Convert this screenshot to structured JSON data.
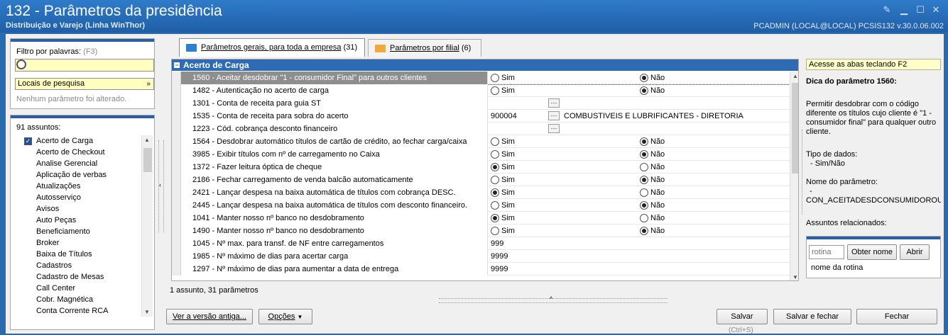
{
  "window": {
    "title": "132 - Parâmetros da presidência",
    "subtitle": "Distribuição e Varejo (Linha WinThor)",
    "user_info": "PCADMIN (LOCAL@LOCAL)   PCSIS132  v.30.0.06.002"
  },
  "filter": {
    "label": "Filtro por palavras:",
    "shortcut": "(F3)",
    "input_value": "",
    "dropdown_value": "Locais de pesquisa",
    "status": "Nenhum parâmetro foi alterado."
  },
  "subjects": {
    "count_label": "91 assuntos:",
    "items": [
      "Acerto de Carga",
      "Acerto de Checkout",
      "Analise Gerencial",
      "Aplicação de verbas",
      "Atualizações",
      "Autosserviço",
      "Avisos",
      "Auto Peças",
      "Beneficiamento",
      "Broker",
      "Baixa de Títulos",
      "Cadastros",
      "Cadastro de Mesas",
      "Call Center",
      "Cobr. Magnética",
      "Conta Corrente RCA"
    ]
  },
  "tabs": [
    {
      "label": "Parâmetros gerais, para toda a empresa",
      "count": "(31)"
    },
    {
      "label": "Parâmetros por filial",
      "count": "(6)"
    }
  ],
  "grid": {
    "group": "Acerto de Carga",
    "sim": "Sim",
    "nao": "Não",
    "rows": [
      {
        "name": "1560 - Aceitar desdobrar \"1 - consumidor Final\" para outros clientes",
        "value": "nao"
      },
      {
        "name": "1482 - Autenticação no acerto de carga",
        "value": "nao"
      },
      {
        "name": "1301 - Conta de receita para guia ST",
        "value": ""
      },
      {
        "name": "1535 - Conta de receita para sobra do acerto",
        "value": "900004",
        "desc": "COMBUSTIVEIS E LUBRIFICANTES - DIRETORIA"
      },
      {
        "name": "1223 - Cód. cobrança desconto financeiro",
        "value": ""
      },
      {
        "name": "1564 - Desdobrar automático títulos de cartão de crédito, ao fechar carga/caixa",
        "value": "nao"
      },
      {
        "name": "3985 - Exibir títulos com nº de carregamento no Caixa",
        "value": "nao"
      },
      {
        "name": "1372 - Fazer leitura óptica de cheque",
        "value": "sim"
      },
      {
        "name": "2186 - Fechar carregamento de venda balcão automaticamente",
        "value": "nao"
      },
      {
        "name": "2421 - Lançar despesa na baixa automática de títulos com cobrança DESC.",
        "value": "sim"
      },
      {
        "name": "2445 - Lançar despesa na baixa automática de títulos com desconto financeiro.",
        "value": "nao"
      },
      {
        "name": "1041 - Manter nosso nº banco no desdobramento",
        "value": "sim"
      },
      {
        "name": "1490 - Manter nosso nº banco no desdobramento",
        "value": "nao"
      },
      {
        "name": "1045 - Nº max. para transf. de NF entre carregamentos",
        "value": "999"
      },
      {
        "name": "1985 - Nº máximo de dias para acertar carga",
        "value": "9999"
      },
      {
        "name": "1297 - Nº máximo de dias para aumentar a data de entrega",
        "value": "9999"
      }
    ],
    "footer": "1 assunto, 31 parâmetros"
  },
  "help": {
    "hint": "Acesse as abas teclando F2",
    "title": "Dica do parâmetro 1560:",
    "description": "Permitir desdobrar com o código diferente os títulos cujo cliente é \"1 - consumidor final\" para qualquer outro cliente.",
    "data_type_label": "Tipo de dados:",
    "data_type_value": "- Sim/Não",
    "param_name_label": "Nome do parâmetro:",
    "param_name_value": "CON_ACEITADESDCONSUMIDOROUT",
    "truncated": "Assuntos relacionados:"
  },
  "routine": {
    "placeholder": "rotina",
    "find_button": "Obter nome",
    "open_button": "Abrir",
    "name_label": "nome da rotina"
  },
  "buttons": {
    "old_version": "Ver a versão antiga...",
    "options": "Opções",
    "save": "Salvar",
    "save_shortcut": "(Ctrl+S)",
    "save_close": "Salvar e fechar",
    "close": "Fechar"
  }
}
